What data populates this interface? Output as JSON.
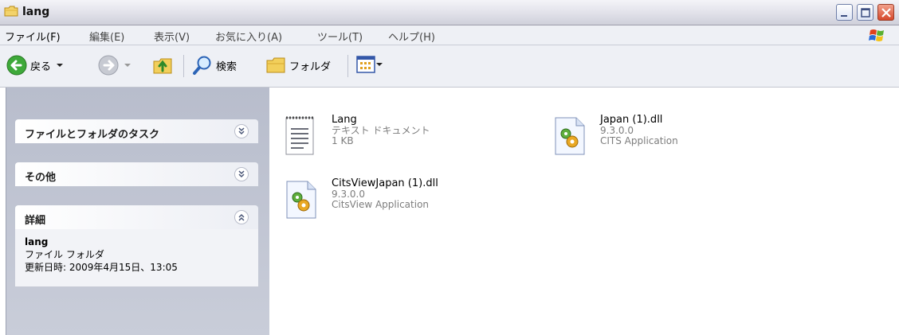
{
  "window": {
    "title": "lang"
  },
  "menu": [
    "ファイル(F)",
    "編集(E)",
    "表示(V)",
    "お気に入り(A)",
    "ツール(T)",
    "ヘルプ(H)"
  ],
  "toolbar": {
    "back_label": "戻る",
    "search_label": "検索",
    "folders_label": "フォルダ"
  },
  "tasks": {
    "file_folder_tasks": "ファイルとフォルダのタスク",
    "other": "その他",
    "details": "詳細",
    "details_body": {
      "name": "lang",
      "type": "ファイル フォルダ",
      "modified": "更新日時: 2009年4月15日、13:05"
    }
  },
  "files": [
    {
      "name": "Lang",
      "line2": "テキスト ドキュメント",
      "line3": "1 KB",
      "icon": "text-document-icon"
    },
    {
      "name": "Japan (1).dll",
      "line2": "9.3.0.0",
      "line3": "CITS  Application",
      "icon": "dll-file-icon"
    },
    {
      "name": "CitsViewJapan (1).dll",
      "line2": "9.3.0.0",
      "line3": "CitsView Application",
      "icon": "dll-file-icon"
    }
  ]
}
